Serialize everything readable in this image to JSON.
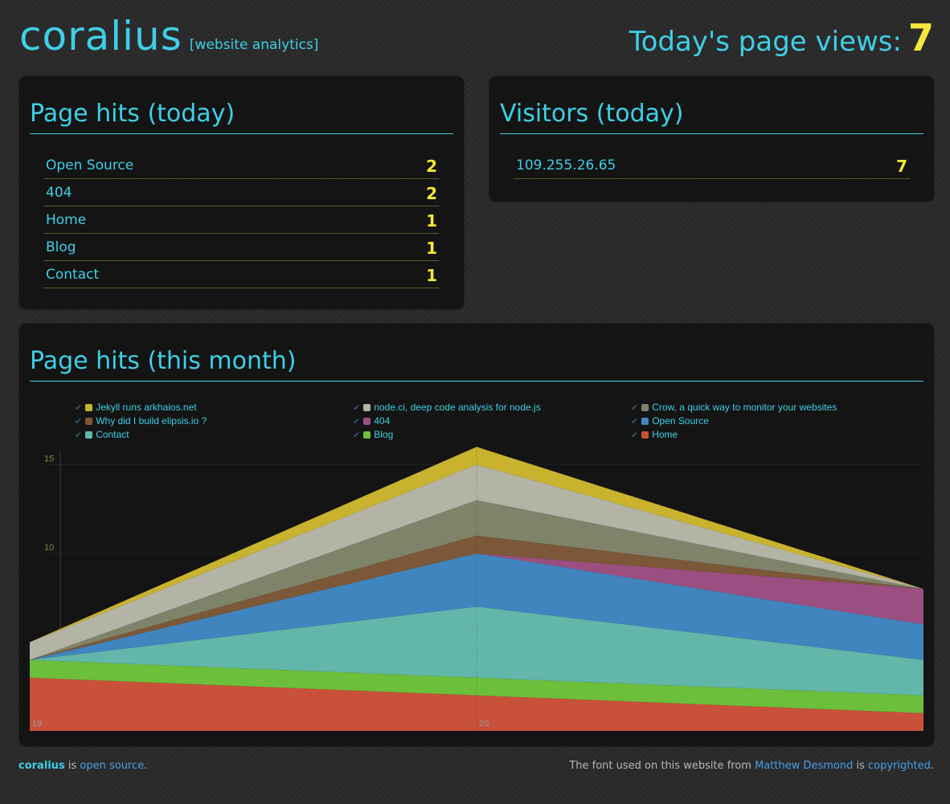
{
  "header": {
    "brand": "coralius",
    "subtitle": "[website analytics]",
    "views_label": "Today's page views:",
    "views_count": "7"
  },
  "page_hits_today": {
    "title": "Page hits (today)",
    "rows": [
      {
        "label": "Open Source",
        "count": "2"
      },
      {
        "label": "404",
        "count": "2"
      },
      {
        "label": "Home",
        "count": "1"
      },
      {
        "label": "Blog",
        "count": "1"
      },
      {
        "label": "Contact",
        "count": "1"
      }
    ]
  },
  "visitors_today": {
    "title": "Visitors (today)",
    "rows": [
      {
        "label": "109.255.26.65",
        "count": "7"
      }
    ]
  },
  "monthly": {
    "title": "Page hits (this month)",
    "legend": [
      {
        "label": "Jekyll runs arkhaios.net",
        "color": "#c9b22e"
      },
      {
        "label": "node.ci, deep code analysis for node.js",
        "color": "#b3b3a6"
      },
      {
        "label": "Crow, a quick way to monitor your websites",
        "color": "#7f836a"
      },
      {
        "label": "Why did I build elipsis.io ?",
        "color": "#7c5838"
      },
      {
        "label": "404",
        "color": "#9b4f80"
      },
      {
        "label": "Open Source",
        "color": "#4185bf"
      },
      {
        "label": "Contact",
        "color": "#63b6aa"
      },
      {
        "label": "Blog",
        "color": "#6cbf3a"
      },
      {
        "label": "Home",
        "color": "#c95039"
      }
    ]
  },
  "chart_data": {
    "type": "area",
    "stacked": true,
    "x_ticks": [
      "19",
      "20"
    ],
    "y_ticks": [
      "10",
      "15"
    ],
    "x": [
      19,
      20,
      21
    ],
    "ylim": [
      0,
      16.2
    ],
    "grid": true,
    "legend_position": "top",
    "series": [
      {
        "name": "Home",
        "values": [
          3,
          2,
          1
        ]
      },
      {
        "name": "Blog",
        "values": [
          1,
          1,
          1
        ]
      },
      {
        "name": "Contact",
        "values": [
          0,
          4,
          2
        ]
      },
      {
        "name": "Open Source",
        "values": [
          0,
          3,
          2
        ]
      },
      {
        "name": "404",
        "values": [
          0,
          0,
          2
        ]
      },
      {
        "name": "Why did I build elipsis.io ?",
        "values": [
          0,
          1,
          0
        ]
      },
      {
        "name": "Crow, a quick way to monitor your websites",
        "values": [
          0,
          2,
          0
        ]
      },
      {
        "name": "node.ci, deep code analysis for node.js",
        "values": [
          1,
          2,
          0
        ]
      },
      {
        "name": "Jekyll runs arkhaios.net",
        "values": [
          0,
          1,
          0
        ]
      }
    ]
  },
  "footer": {
    "left_name": "coralius",
    "left_is": " is ",
    "left_link": "open source",
    "left_end": ".",
    "right_text": "The font used on this website from ",
    "right_link1": "Matthew Desmond",
    "right_is": " is ",
    "right_link2": "copyrighted",
    "right_end": "."
  }
}
